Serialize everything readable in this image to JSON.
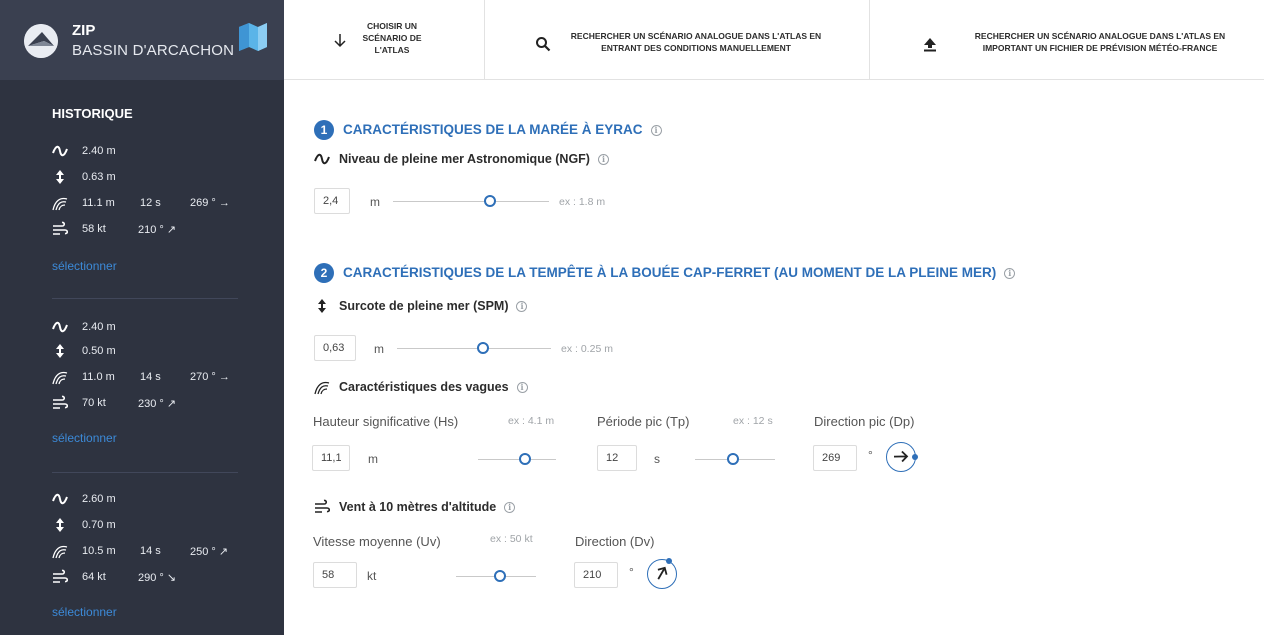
{
  "brand": {
    "zip": "ZIP",
    "name": "BASSIN D'ARCACHON"
  },
  "tabs": [
    {
      "label": "CHOISIR UN SCÉNARIO DE L'ATLAS",
      "icon": "arrow-down-icon"
    },
    {
      "label": "RECHERCHER UN SCÉNARIO ANALOGUE DANS L'ATLAS EN ENTRANT DES CONDITIONS MANUELLEMENT",
      "icon": "search-icon"
    },
    {
      "label": "RECHERCHER UN SCÉNARIO ANALOGUE DANS L'ATLAS EN IMPORTANT UN FICHIER DE PRÉVISION MÉTÉO-FRANCE",
      "icon": "upload-icon"
    }
  ],
  "sidebar": {
    "history_title": "HISTORIQUE",
    "select_label": "sélectionner",
    "entries": [
      {
        "tide": "2.40 m",
        "surge": "0.63 m",
        "wave_height": "11.1 m",
        "wave_period": "12 s",
        "wave_dir": "269 ° →",
        "wind_speed": "58 kt",
        "wind_dir": "210 ° ↗"
      },
      {
        "tide": "2.40 m",
        "surge": "0.50 m",
        "wave_height": "11.0 m",
        "wave_period": "14 s",
        "wave_dir": "270 ° →",
        "wind_speed": "70 kt",
        "wind_dir": "230 ° ↗"
      },
      {
        "tide": "2.60 m",
        "surge": "0.70 m",
        "wave_height": "10.5 m",
        "wave_period": "14 s",
        "wave_dir": "250 ° ↗",
        "wind_speed": "64 kt",
        "wind_dir": "290 ° ↘"
      }
    ]
  },
  "section1": {
    "number": "1",
    "title": "CARACTÉRISTIQUES DE LA MARÉE À EYRAC",
    "tide": {
      "title": "Niveau de pleine mer Astronomique (NGF)",
      "value": "2,4",
      "unit": "m",
      "example": "ex : 1.8 m",
      "slider_fraction": 0.62
    }
  },
  "section2": {
    "number": "2",
    "title": "CARACTÉRISTIQUES DE LA TEMPÊTE À LA BOUÉE CAP-FERRET (AU MOMENT DE LA PLEINE MER)",
    "surge": {
      "title": "Surcote de pleine mer (SPM)",
      "value": "0,63",
      "unit": "m",
      "example": "ex : 0.25 m",
      "slider_fraction": 0.56
    },
    "waves": {
      "title": "Caractéristiques des vagues",
      "hs": {
        "label": "Hauteur significative (Hs)",
        "example": "ex : 4.1 m",
        "value": "11,1",
        "unit": "m",
        "slider_fraction": 0.6
      },
      "tp": {
        "label": "Période pic (Tp)",
        "example": "ex : 12 s",
        "value": "12",
        "unit": "s",
        "slider_fraction": 0.48
      },
      "dp": {
        "label": "Direction pic (Dp)",
        "value": "269",
        "unit": "°",
        "direction_deg": 269
      }
    },
    "wind": {
      "title": "Vent à 10 mètres d'altitude",
      "uv": {
        "label": "Vitesse moyenne (Uv)",
        "example": "ex : 50 kt",
        "value": "58",
        "unit": "kt",
        "slider_fraction": 0.55
      },
      "dv": {
        "label": "Direction (Dv)",
        "value": "210",
        "unit": "°",
        "direction_deg": 210
      }
    }
  },
  "colors": {
    "accent": "#2e6fb8",
    "sidebar": "#2e3340",
    "link": "#3c8ad8"
  }
}
